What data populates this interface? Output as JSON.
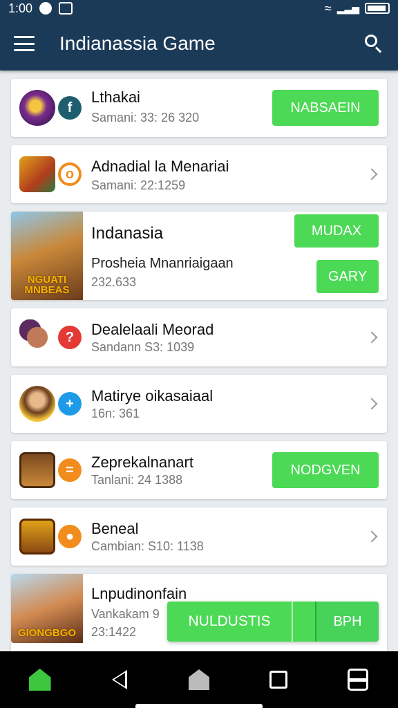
{
  "status": {
    "time": "1:00"
  },
  "appbar": {
    "title": "Indianassia Game"
  },
  "items": [
    {
      "title": "Lthakai",
      "sub": "Samani: 33: 26 320",
      "button": "NABSAEIN",
      "badge_color": "#1e5e6e",
      "badge_glyph": "f"
    },
    {
      "title": "Adnadial la Menariai",
      "sub": "Samani: 22:1259",
      "badge_color": "#f28c1c",
      "badge_glyph": "o"
    },
    {
      "title": "Indanasia",
      "sub": "Prosheia  Mnanriaigaan",
      "sub2": "232.633",
      "button1": "MUDAX",
      "button2": "GARY",
      "thumb_caption": "NGUATI MNBEAS"
    },
    {
      "title": "Dealelaali Meorad",
      "sub": "Sandann S3: 1039",
      "badge_color": "#e53935",
      "badge_glyph": "?"
    },
    {
      "title": "Matirye oikasaiaal",
      "sub": "16n: 361",
      "badge_color": "#1e9be8",
      "badge_glyph": "+"
    },
    {
      "title": "Zeprekalnanart",
      "sub": "Tanlani: 24 1388",
      "button": "NODGVEN",
      "badge_color": "#f28c1c",
      "badge_glyph": "="
    },
    {
      "title": "Beneal",
      "sub": "Cambian: S10: 1138",
      "badge_color": "#f28c1c",
      "badge_glyph": "●"
    },
    {
      "title": "Lnpudinonfain",
      "sub": "Vankakam 9",
      "sub2": "23:1422",
      "thumb_caption": "GIONGBGO"
    }
  ],
  "floating": {
    "left": "NULDUSTIS",
    "right": "BPH"
  },
  "colors": {
    "accent_green": "#4cd955",
    "appbar": "#1b3a57"
  }
}
